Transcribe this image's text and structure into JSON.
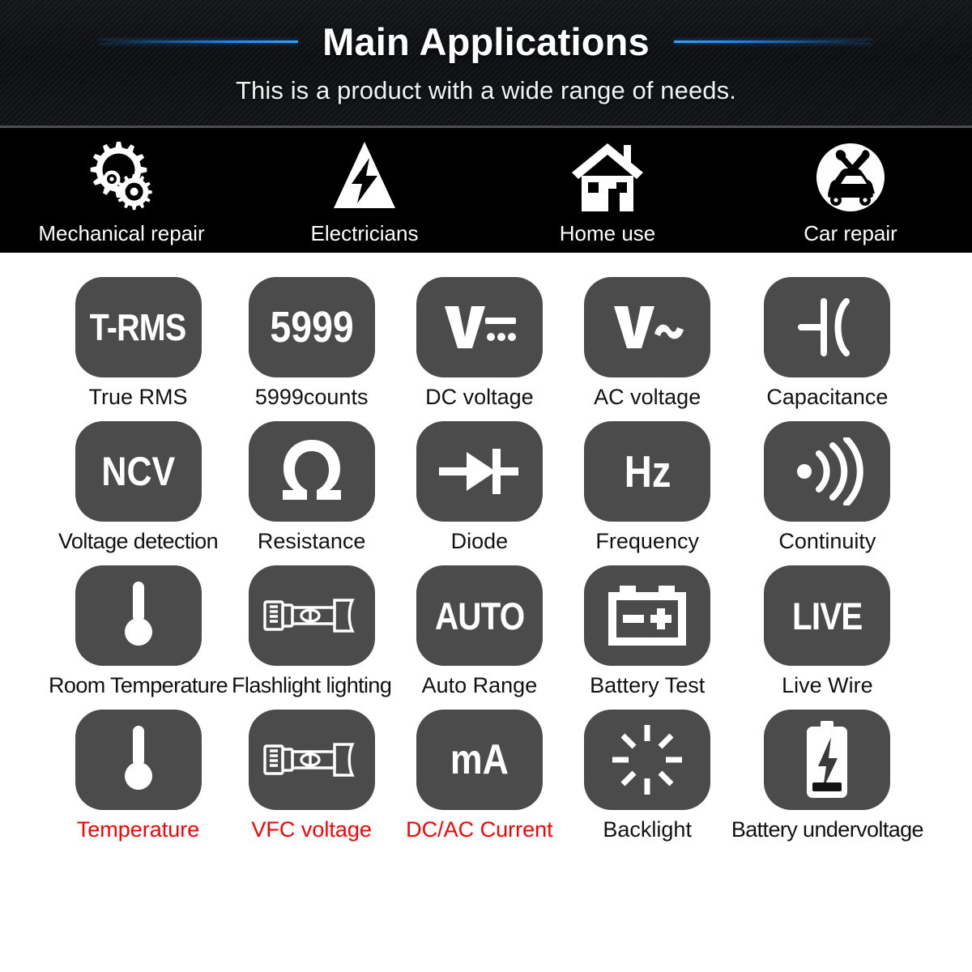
{
  "header": {
    "title": "Main Applications",
    "subtitle": "This is a product with a wide range of needs.",
    "accent_color": "#1e90ff",
    "background_color": "#101114"
  },
  "applications": [
    {
      "label": "Mechanical repair",
      "icon": "gears-icon"
    },
    {
      "label": "Electricians",
      "icon": "high-voltage-triangle-icon"
    },
    {
      "label": "Home use",
      "icon": "house-icon"
    },
    {
      "label": "Car repair",
      "icon": "car-repair-icon"
    }
  ],
  "features": {
    "tile_color": "#4b4b4b",
    "label_color": "#111111",
    "highlight_label_color": "#ff0000",
    "items": [
      {
        "glyph": "T-RMS",
        "label": "True RMS",
        "icon": "t-rms-text-icon",
        "highlight": false
      },
      {
        "glyph": "5999",
        "label": "5999counts",
        "icon": "5999-counts-text-icon",
        "highlight": false
      },
      {
        "glyph": "",
        "label": "DC voltage",
        "icon": "dc-voltage-icon",
        "highlight": false
      },
      {
        "glyph": "",
        "label": "AC voltage",
        "icon": "ac-voltage-icon",
        "highlight": false
      },
      {
        "glyph": "",
        "label": "Capacitance",
        "icon": "capacitor-icon",
        "highlight": false
      },
      {
        "glyph": "NCV",
        "label": "Voltage detection",
        "icon": "ncv-text-icon",
        "highlight": false
      },
      {
        "glyph": "",
        "label": "Resistance",
        "icon": "ohm-icon",
        "highlight": false
      },
      {
        "glyph": "",
        "label": "Diode",
        "icon": "diode-icon",
        "highlight": false
      },
      {
        "glyph": "Hz",
        "label": "Frequency",
        "icon": "hz-text-icon",
        "highlight": false
      },
      {
        "glyph": "",
        "label": "Continuity",
        "icon": "continuity-buzzer-icon",
        "highlight": false
      },
      {
        "glyph": "",
        "label": "Room Temperature",
        "icon": "thermometer-icon",
        "highlight": false
      },
      {
        "glyph": "",
        "label": "Flashlight lighting",
        "icon": "flashlight-icon",
        "highlight": false
      },
      {
        "glyph": "AUTO",
        "label": "Auto Range",
        "icon": "auto-text-icon",
        "highlight": false
      },
      {
        "glyph": "",
        "label": "Battery Test",
        "icon": "car-battery-icon",
        "highlight": false
      },
      {
        "glyph": "LIVE",
        "label": "Live Wire",
        "icon": "live-text-icon",
        "highlight": false
      },
      {
        "glyph": "",
        "label": "Temperature",
        "icon": "thermometer-icon",
        "highlight": true
      },
      {
        "glyph": "",
        "label": "VFC voltage",
        "icon": "flashlight-icon",
        "highlight": true
      },
      {
        "glyph": "mA",
        "label": "DC/AC Current",
        "icon": "ma-text-icon",
        "highlight": true
      },
      {
        "glyph": "",
        "label": "Backlight",
        "icon": "backlight-rays-icon",
        "highlight": false
      },
      {
        "glyph": "",
        "label": "Battery undervoltage",
        "icon": "battery-bolt-icon",
        "highlight": false
      }
    ]
  }
}
